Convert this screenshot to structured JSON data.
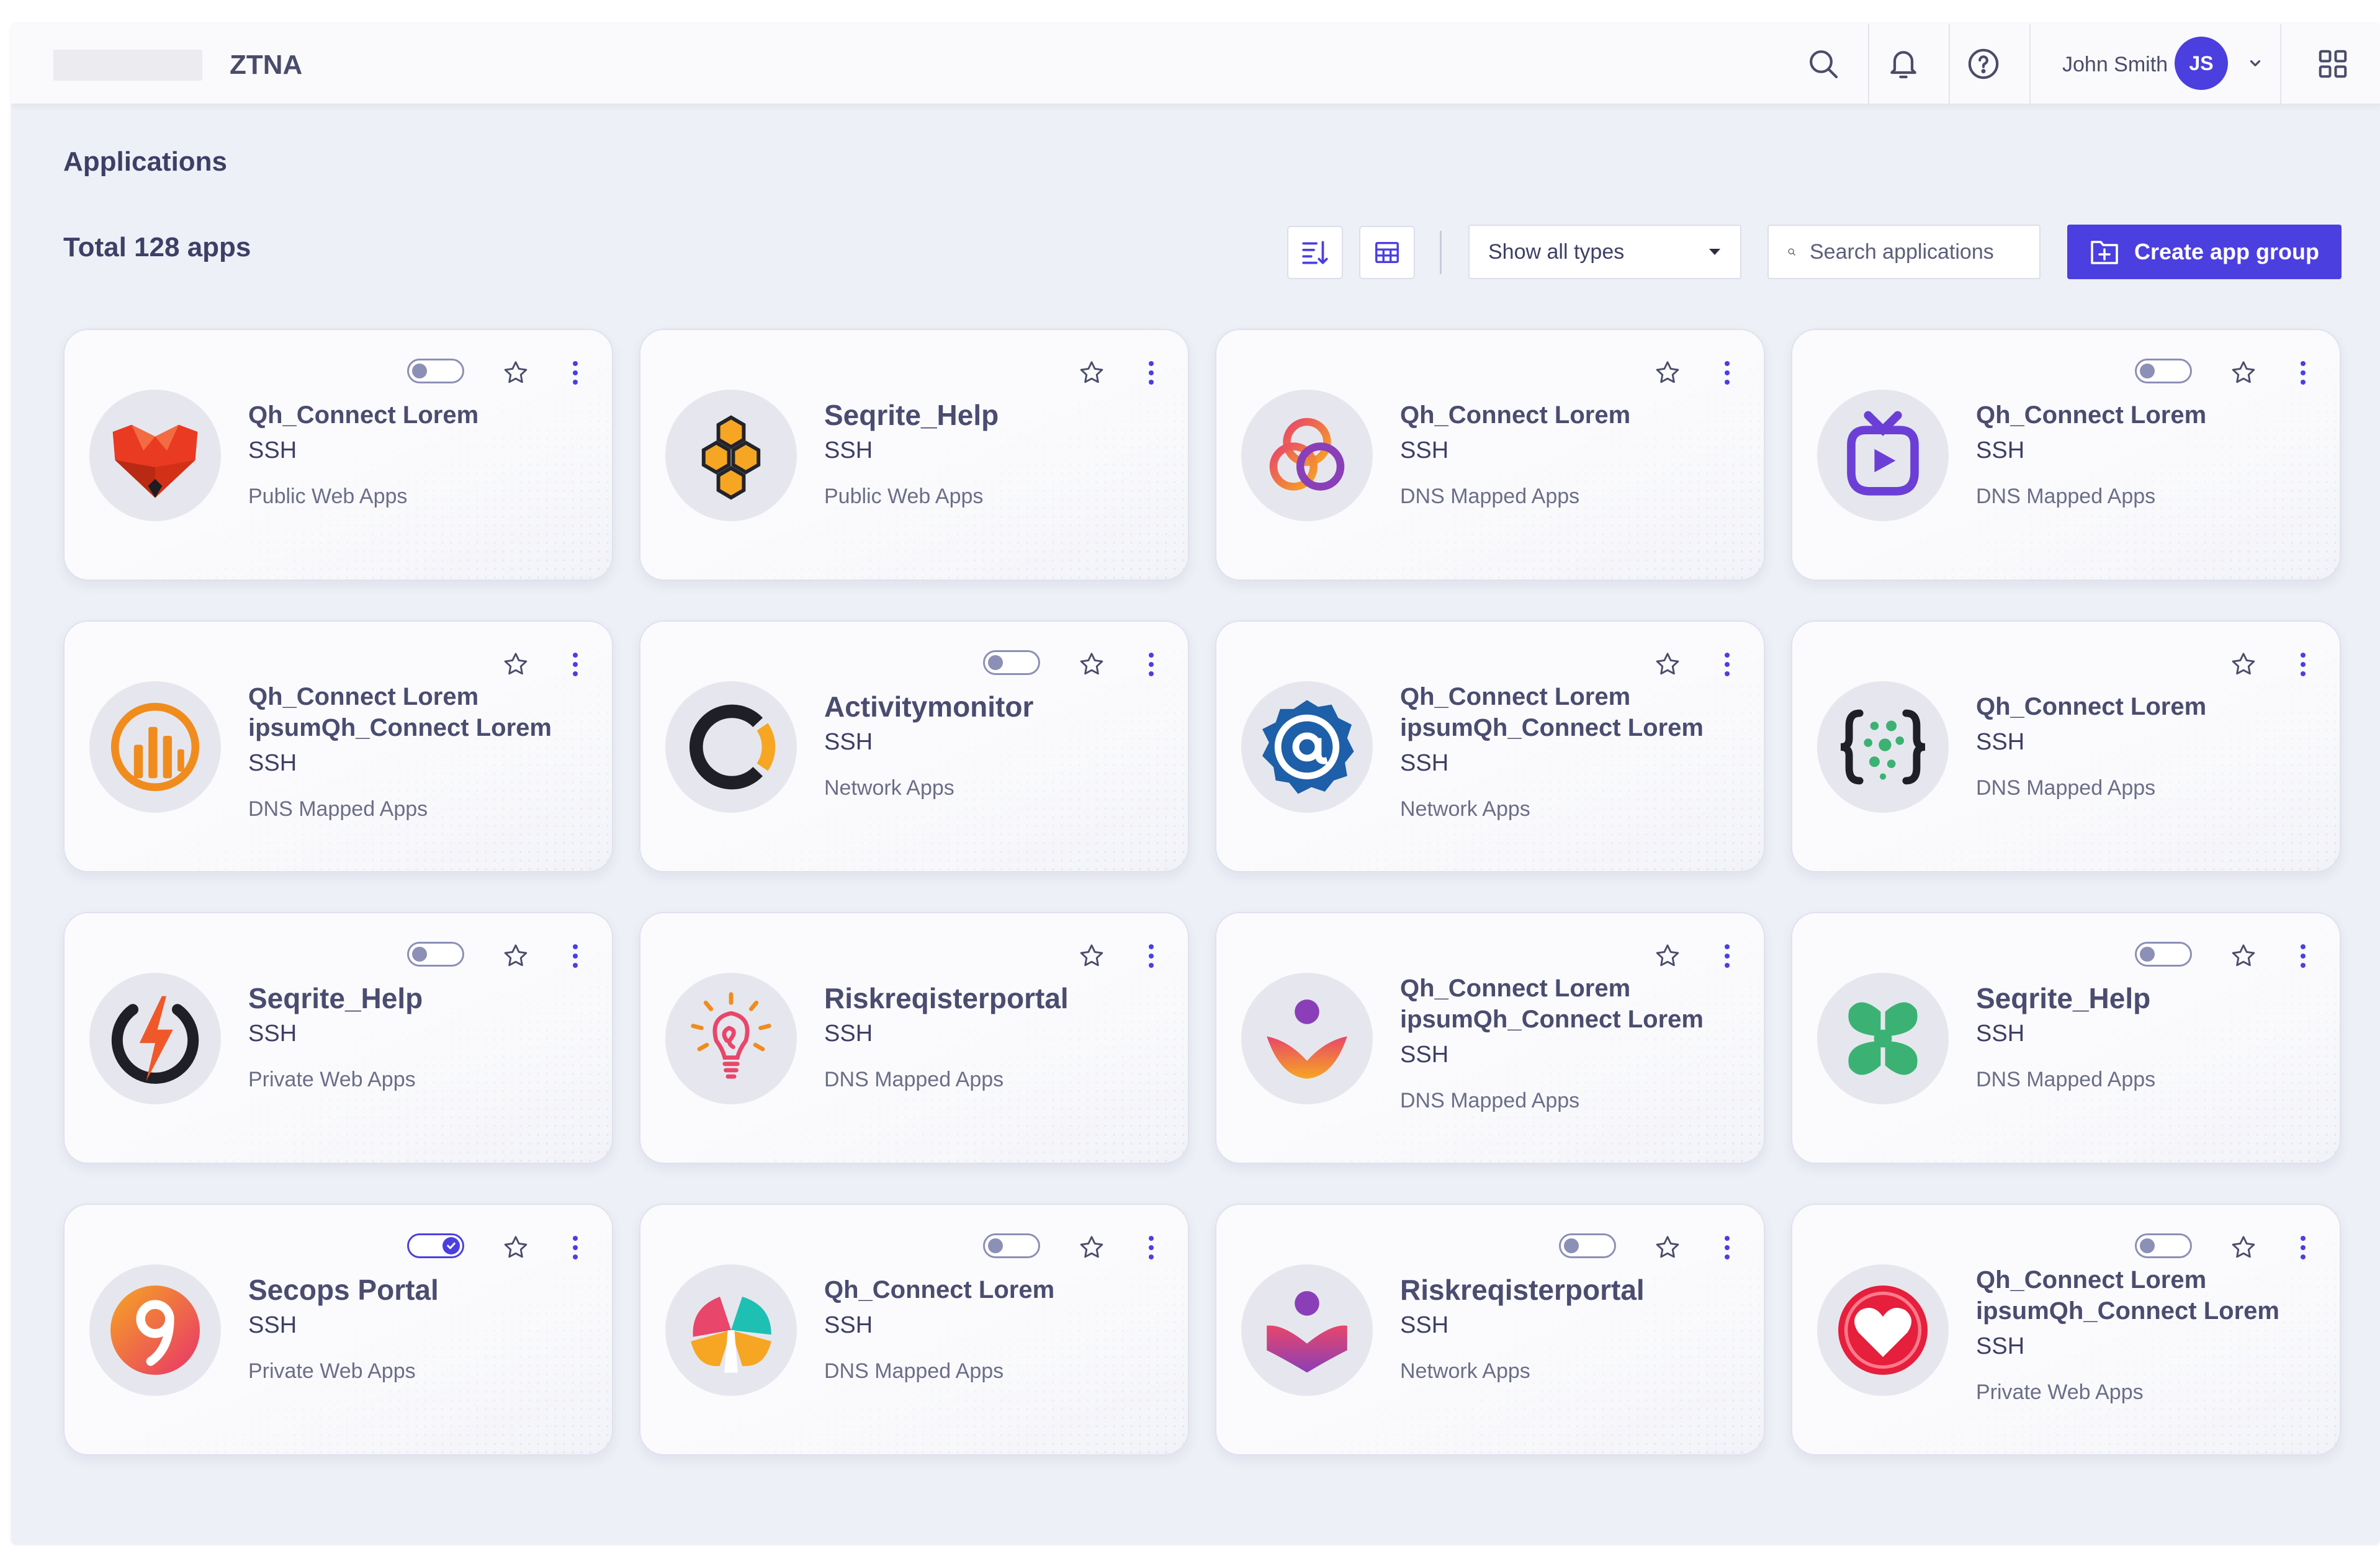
{
  "header": {
    "product": "ZTNA",
    "user_name": "John Smith",
    "user_initials": "JS"
  },
  "page_title": "Applications",
  "total_label": "Total 128 apps",
  "toolbar": {
    "type_filter": "Show all types",
    "search_placeholder": "Search applications",
    "create_label": "Create app group"
  },
  "apps": [
    {
      "name": "Qh_Connect Lorem",
      "protocol": "SSH",
      "category": "Public Web Apps",
      "toggle": "off",
      "icon": "fox-logo"
    },
    {
      "name": "Seqrite_Help",
      "protocol": "SSH",
      "category": "Public Web Apps",
      "toggle": "none",
      "icon": "honeycomb-logo"
    },
    {
      "name": "Qh_Connect Lorem",
      "protocol": "SSH",
      "category": "DNS Mapped Apps",
      "toggle": "none",
      "icon": "triquetra-logo"
    },
    {
      "name": "Qh_Connect Lorem",
      "protocol": "SSH",
      "category": "DNS Mapped Apps",
      "toggle": "off",
      "icon": "tv-play-logo"
    },
    {
      "name": "Qh_Connect Lorem ipsumQh_Connect Lorem",
      "protocol": "SSH",
      "category": "DNS Mapped Apps",
      "toggle": "none",
      "icon": "bar-chart-logo"
    },
    {
      "name": "Activitymonitor",
      "protocol": "SSH",
      "category": "Network Apps",
      "toggle": "off",
      "icon": "ring-logo"
    },
    {
      "name": "Qh_Connect Lorem ipsumQh_Connect Lorem",
      "protocol": "SSH",
      "category": "Network Apps",
      "toggle": "none",
      "icon": "at-sign-logo"
    },
    {
      "name": "Qh_Connect Lorem",
      "protocol": "SSH",
      "category": "DNS Mapped Apps",
      "toggle": "none",
      "icon": "braces-dots-logo"
    },
    {
      "name": "Seqrite_Help",
      "protocol": "SSH",
      "category": "Private Web Apps",
      "toggle": "off",
      "icon": "power-bolt-logo"
    },
    {
      "name": "Riskreqisterportal",
      "protocol": "SSH",
      "category": "DNS Mapped Apps",
      "toggle": "none",
      "icon": "lightbulb-logo"
    },
    {
      "name": "Qh_Connect Lorem ipsumQh_Connect Lorem",
      "protocol": "SSH",
      "category": "DNS Mapped Apps",
      "toggle": "none",
      "icon": "lotus-person-logo"
    },
    {
      "name": "Seqrite_Help",
      "protocol": "SSH",
      "category": "DNS Mapped Apps",
      "toggle": "off",
      "icon": "clover-logo"
    },
    {
      "name": "Secops Portal",
      "protocol": "SSH",
      "category": "Private Web Apps",
      "toggle": "on",
      "icon": "nine-logo"
    },
    {
      "name": "Qh_Connect Lorem",
      "protocol": "SSH",
      "category": "DNS Mapped Apps",
      "toggle": "off",
      "icon": "petal-logo"
    },
    {
      "name": "Riskreqisterportal",
      "protocol": "SSH",
      "category": "Network Apps",
      "toggle": "off",
      "icon": "person-heart-logo"
    },
    {
      "name": "Qh_Connect Lorem ipsumQh_Connect Lorem",
      "protocol": "SSH",
      "category": "Private Web Apps",
      "toggle": "off",
      "icon": "heart-badge-logo"
    }
  ],
  "colors": {
    "accent": "#4b3fe0",
    "background": "#eef0f7",
    "text": "#3d3f66"
  }
}
